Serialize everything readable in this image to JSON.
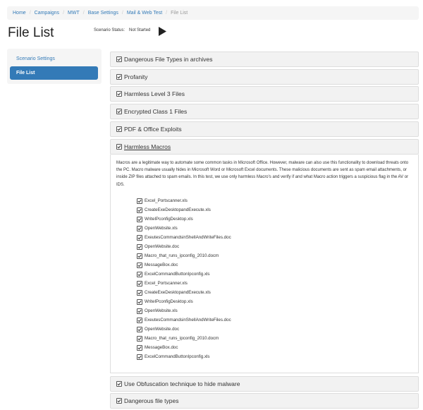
{
  "breadcrumb": {
    "items": [
      "Home",
      "Campaigns",
      "MWT",
      "Base Settings",
      "Mail & Web Test"
    ],
    "current": "File List",
    "separator": "/"
  },
  "page": {
    "title": "File List",
    "status_label": "Scenario Status:",
    "status_value": "Not Started"
  },
  "sidebar": {
    "items": [
      {
        "label": "Scenario Settings",
        "active": false
      },
      {
        "label": "File List",
        "active": true
      }
    ]
  },
  "panels": [
    {
      "label": "Dangerous File Types in archives"
    },
    {
      "label": "Profanity"
    },
    {
      "label": "Harmless Level 3 Files"
    },
    {
      "label": "Encrypted Class 1 Files"
    },
    {
      "label": "PDF & Office Exploits"
    },
    {
      "label": "Harmless Macros",
      "expanded": true
    },
    {
      "label": "Use Obfuscation technique to hide malware"
    },
    {
      "label": "Dangerous file types"
    }
  ],
  "macros": {
    "description": "Macros are a legitimate way to automate some common tasks in Microsoft Office. However, malware can also use this functionality to download threats onto the PC. Macro malware usually hides in Microsoft Word or Microsoft Excel documents. These malicious documents are sent as spam email attachments, or inside ZIP files attached to spam emails. In this test, we use only harmless Macro's and verify if and what Macro action triggers a suspicious flag in the AV or IDS.",
    "files": [
      "Excel_Portscanner.xls",
      "CreateExeDesktopandExecute.xls",
      "WriteIPconfigDesktop.xls",
      "OpenWebsite.xls",
      "ExeutesCommandsinShellAndWriteFiles.doc",
      "OpenWebsite.doc",
      "Macro_that_runs_ipconfig_2010.docm",
      "MessageBox.doc",
      "ExcelCommandButtonIpconfig.xls",
      "Excel_Portscanner.xls",
      "CreateExeDesktopandExecute.xls",
      "WriteIPconfigDesktop.xls",
      "OpenWebsite.xls",
      "ExeutesCommandsinShellAndWriteFiles.doc",
      "OpenWebsite.doc",
      "Macro_that_runs_ipconfig_2010.docm",
      "MessageBox.doc",
      "ExcelCommandButtonIpconfig.xls"
    ]
  },
  "colors": {
    "link": "#337ab7",
    "active_bg": "#337ab7",
    "panel_bg": "#f2f2f2",
    "breadcrumb_bg": "#f5f5f5"
  },
  "icons": {
    "checkbox": "checkbox-checked-icon",
    "play": "play-icon"
  }
}
